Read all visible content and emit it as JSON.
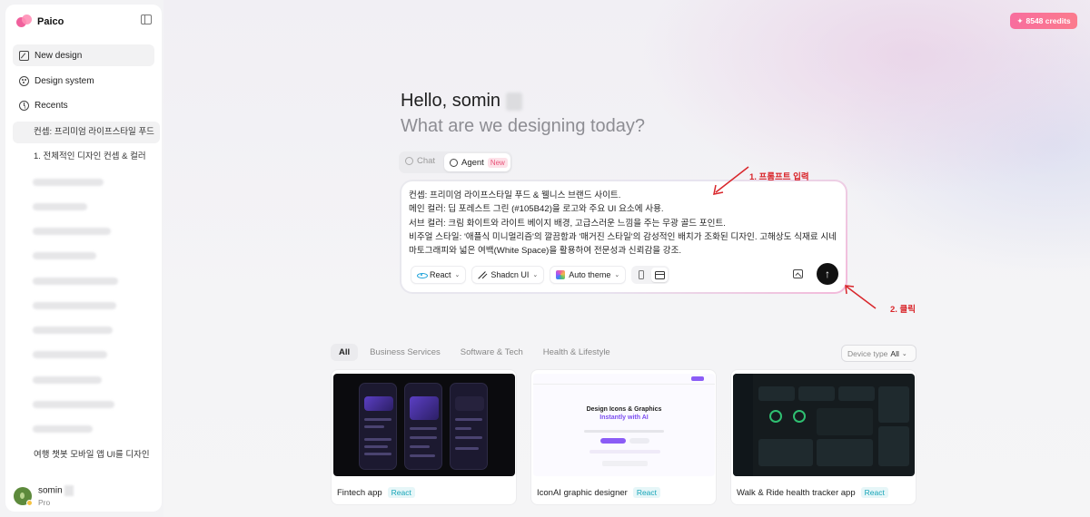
{
  "app": {
    "name": "Paico"
  },
  "credits": {
    "label": "8548 credits"
  },
  "sidebar": {
    "new_design": "New design",
    "design_system": "Design system",
    "recents_label": "Recents",
    "recents": [
      "컨셉: 프리미엄 라이프스타일 푸드",
      "1. 전체적인 디자인 컨셉 & 컬러"
    ],
    "recent_last": "여행 챗봇 모바일 앱 UI를 디자인"
  },
  "user": {
    "name": "somin",
    "plan": "Pro"
  },
  "hero": {
    "greeting": "Hello, somin",
    "subtitle": "What are we designing today?"
  },
  "mode": {
    "chat": "Chat",
    "agent": "Agent",
    "agent_badge": "New"
  },
  "prompt": {
    "text": "컨셉: 프리미엄 라이프스타일 푸드 & 웰니스 브랜드 사이트.\n메인 컬러: 딥 포레스트 그린 (#105B42)을 로고와 주요 UI 요소에 사용.\n서브 컬러: 크림 화이트와 라이트 베이지 배경, 고급스러운 느낌을 주는 무광 골드 포인트.\n비주얼 스타일: '애플식 미니멀리즘'의 깔끔함과 '매거진 스타일'의 감성적인 배치가 조화된 디자인. 고해상도 식재료 시네마토그래피와 넓은 여백(White Space)을 활용하여 전문성과 신뢰감을 강조.",
    "framework": "React",
    "ui_lib": "Shadcn UI",
    "theme": "Auto theme"
  },
  "annotations": {
    "step1": "1. 프롬프트 입력",
    "step2": "2. 클릭"
  },
  "filters": {
    "tabs": [
      "All",
      "Business Services",
      "Software & Tech",
      "Health & Lifestyle"
    ],
    "device_label": "Device type",
    "device_value": "All"
  },
  "cards": [
    {
      "title": "Fintech app",
      "tag": "React"
    },
    {
      "title": "IconAI graphic designer",
      "tag": "React"
    },
    {
      "title": "Walk & Ride health tracker app",
      "tag": "React"
    }
  ],
  "thumb_texts": {
    "iconai_h1": "Design Icons & Graphics",
    "iconai_h2": "Instantly with AI"
  }
}
